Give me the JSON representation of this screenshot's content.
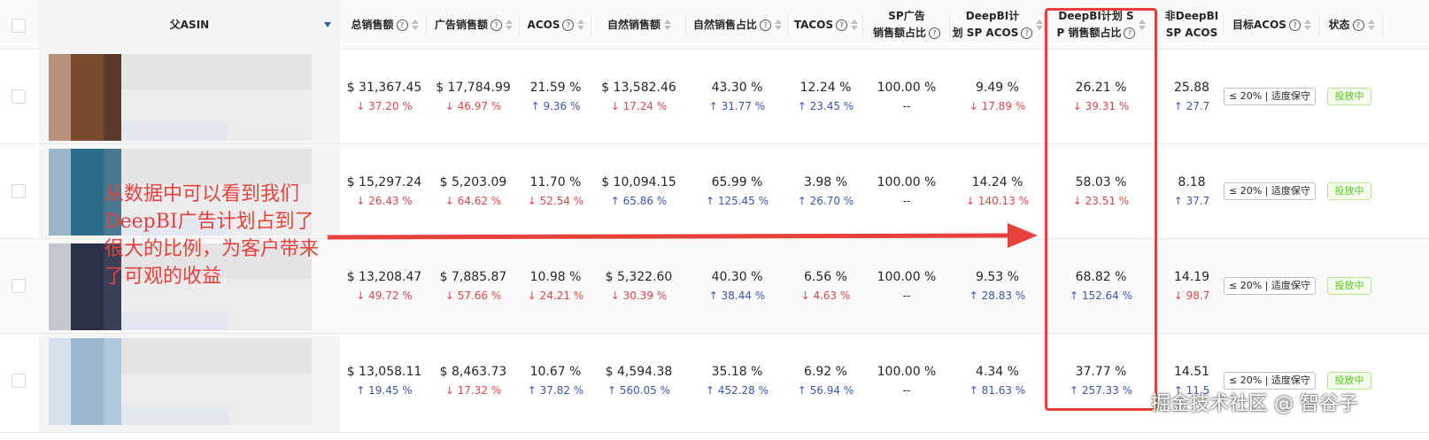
{
  "header": {
    "parent_asin": "父ASIN",
    "cols": [
      {
        "label": "总销售额",
        "q": true
      },
      {
        "label": "广告销售额",
        "q": true
      },
      {
        "label": "ACOS",
        "q": true
      },
      {
        "label": "自然销售额",
        "q": false
      },
      {
        "label": "自然销售占比",
        "q": true
      },
      {
        "label": "TACOS",
        "q": true
      },
      {
        "label": "SP广告销售额占比",
        "q": true
      },
      {
        "label": "DeepBI计划 SP ACOS",
        "q": true
      },
      {
        "label": "DeepBI计划 SP 销售额占比",
        "q": true
      },
      {
        "label": "非DeepBI SP ACOS",
        "q": false
      },
      {
        "label": "目标ACOS",
        "q": true
      },
      {
        "label": "状态",
        "q": true
      }
    ],
    "q_glyph": "?"
  },
  "rows": [
    {
      "cells": [
        {
          "v": "$ 31,367.45",
          "c": "37.20 %",
          "d": "down"
        },
        {
          "v": "$ 17,784.99",
          "c": "46.97 %",
          "d": "down"
        },
        {
          "v": "21.59 %",
          "c": "9.36 %",
          "d": "up"
        },
        {
          "v": "$ 13,582.46",
          "c": "17.24 %",
          "d": "down"
        },
        {
          "v": "43.30 %",
          "c": "31.77 %",
          "d": "up"
        },
        {
          "v": "12.24 %",
          "c": "23.45 %",
          "d": "up"
        },
        {
          "v": "100.00 %",
          "c": "--",
          "d": "neutral"
        },
        {
          "v": "9.49 %",
          "c": "17.89 %",
          "d": "down"
        },
        {
          "v": "26.21 %",
          "c": "39.31 %",
          "d": "down"
        },
        {
          "v": "25.88",
          "c": "27.7",
          "d": "up"
        }
      ],
      "tag": "≤ 20% | 适度保守",
      "status": "投放中"
    },
    {
      "cells": [
        {
          "v": "$ 15,297.24",
          "c": "26.43 %",
          "d": "down"
        },
        {
          "v": "$ 5,203.09",
          "c": "64.62 %",
          "d": "down"
        },
        {
          "v": "11.70 %",
          "c": "52.54 %",
          "d": "down"
        },
        {
          "v": "$ 10,094.15",
          "c": "65.86 %",
          "d": "up"
        },
        {
          "v": "65.99 %",
          "c": "125.45 %",
          "d": "up"
        },
        {
          "v": "3.98 %",
          "c": "26.70 %",
          "d": "up"
        },
        {
          "v": "100.00 %",
          "c": "--",
          "d": "neutral"
        },
        {
          "v": "14.24 %",
          "c": "140.13 %",
          "d": "down"
        },
        {
          "v": "58.03 %",
          "c": "23.51 %",
          "d": "down"
        },
        {
          "v": "8.18",
          "c": "37.7",
          "d": "up"
        }
      ],
      "tag": "≤ 20% | 适度保守",
      "status": "投放中"
    },
    {
      "cells": [
        {
          "v": "$ 13,208.47",
          "c": "49.72 %",
          "d": "down"
        },
        {
          "v": "$ 7,885.87",
          "c": "57.66 %",
          "d": "down"
        },
        {
          "v": "10.98 %",
          "c": "24.21 %",
          "d": "down"
        },
        {
          "v": "$ 5,322.60",
          "c": "30.39 %",
          "d": "down"
        },
        {
          "v": "40.30 %",
          "c": "38.44 %",
          "d": "up"
        },
        {
          "v": "6.56 %",
          "c": "4.63 %",
          "d": "down"
        },
        {
          "v": "100.00 %",
          "c": "--",
          "d": "neutral"
        },
        {
          "v": "9.53 %",
          "c": "28.83 %",
          "d": "up"
        },
        {
          "v": "68.82 %",
          "c": "152.64 %",
          "d": "up"
        },
        {
          "v": "14.19",
          "c": "98.7",
          "d": "down"
        }
      ],
      "tag": "≤ 20% | 适度保守",
      "status": "投放中"
    },
    {
      "cells": [
        {
          "v": "$ 13,058.11",
          "c": "19.45 %",
          "d": "up"
        },
        {
          "v": "$ 8,463.73",
          "c": "17.32 %",
          "d": "down"
        },
        {
          "v": "10.67 %",
          "c": "37.82 %",
          "d": "up"
        },
        {
          "v": "$ 4,594.38",
          "c": "560.05 %",
          "d": "up"
        },
        {
          "v": "35.18 %",
          "c": "452.28 %",
          "d": "up"
        },
        {
          "v": "6.92 %",
          "c": "56.94 %",
          "d": "up"
        },
        {
          "v": "100.00 %",
          "c": "--",
          "d": "neutral"
        },
        {
          "v": "4.34 %",
          "c": "81.63 %",
          "d": "up"
        },
        {
          "v": "37.77 %",
          "c": "257.33 %",
          "d": "up"
        },
        {
          "v": "14.51",
          "c": "11.5",
          "d": "up"
        }
      ],
      "tag": "≤ 20% | 适度保守",
      "status": "投放中"
    }
  ],
  "thumb_colors": [
    [
      "#b8927c",
      "#7a4a2c",
      "#5a3a2a"
    ],
    [
      "#9ab4c8",
      "#2c6c86",
      "#4a7890"
    ],
    [
      "#c4c8d0",
      "#2a3048",
      "#3a4058"
    ],
    [
      "#d4e0ec",
      "#9cb8d0",
      "#b0c8dc"
    ]
  ],
  "annotation": "从数据中可以看到我们DeepBI广告计划占到了很大的比例，为客户带来了可观的收益",
  "watermark": "掘金技术社区 @ 智谷子",
  "colors": {
    "accent_red": "#e8413b",
    "down": "#e0474b",
    "up": "#3a57b0",
    "status_green": "#52c41a"
  }
}
